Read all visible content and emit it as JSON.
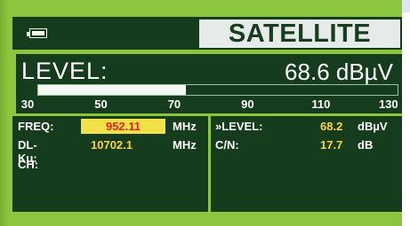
{
  "app": {
    "title": "SATELLITE"
  },
  "level": {
    "label": "LEVEL:",
    "value_text": "68.6 dBµV",
    "bar_fraction": 0.41,
    "scale_ticks": [
      "30",
      "50",
      "70",
      "90",
      "110",
      "130"
    ]
  },
  "info": {
    "freq_label": "FREQ:",
    "freq_value": "952.11",
    "freq_unit": "MHz",
    "dl_label": "DL-Ku:",
    "dl_value": "10702.1",
    "dl_unit": "MHz",
    "ch_label": "CH:",
    "rlevel_label": "»LEVEL:",
    "rlevel_value": "68.2",
    "rlevel_unit": "dBµV",
    "cn_label": "C/N:",
    "cn_value": "17.7",
    "cn_unit": "dB"
  },
  "colors": {
    "body_green": "#8cc63e",
    "panel_dark": "#153c1c",
    "value_yellow": "#ffd23f",
    "freq_highlight": "#f2e24a",
    "freq_text_red": "#e2231a"
  }
}
